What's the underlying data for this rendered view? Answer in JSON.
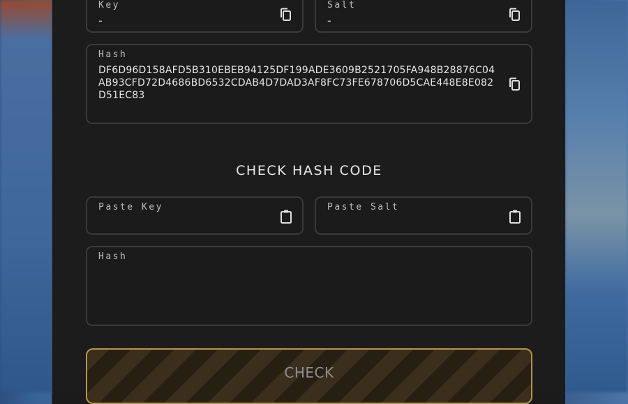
{
  "generate": {
    "key": {
      "label": "Key",
      "value": "-"
    },
    "salt": {
      "label": "Salt",
      "value": "-"
    },
    "hash": {
      "label": "Hash",
      "value": "DF6D96D158AFD5B310EBEB94125DF199ADE3609B2521705FA948B28876C04AB93CFD72D4686BD6532CDAB4D7DAD3AF8FC73FE678706D5CAE448E8E082D51EC83"
    }
  },
  "check": {
    "title": "CHECK HASH CODE",
    "key_label": "Paste Key",
    "salt_label": "Paste Salt",
    "hash_label": "Hash",
    "button_label": "CHECK"
  },
  "icons": {
    "copy": "copy-icon",
    "paste": "clipboard-paste-icon"
  },
  "colors": {
    "panel": "#1c1c1c",
    "field_border": "#3a3a3a",
    "accent": "#b8944a"
  }
}
